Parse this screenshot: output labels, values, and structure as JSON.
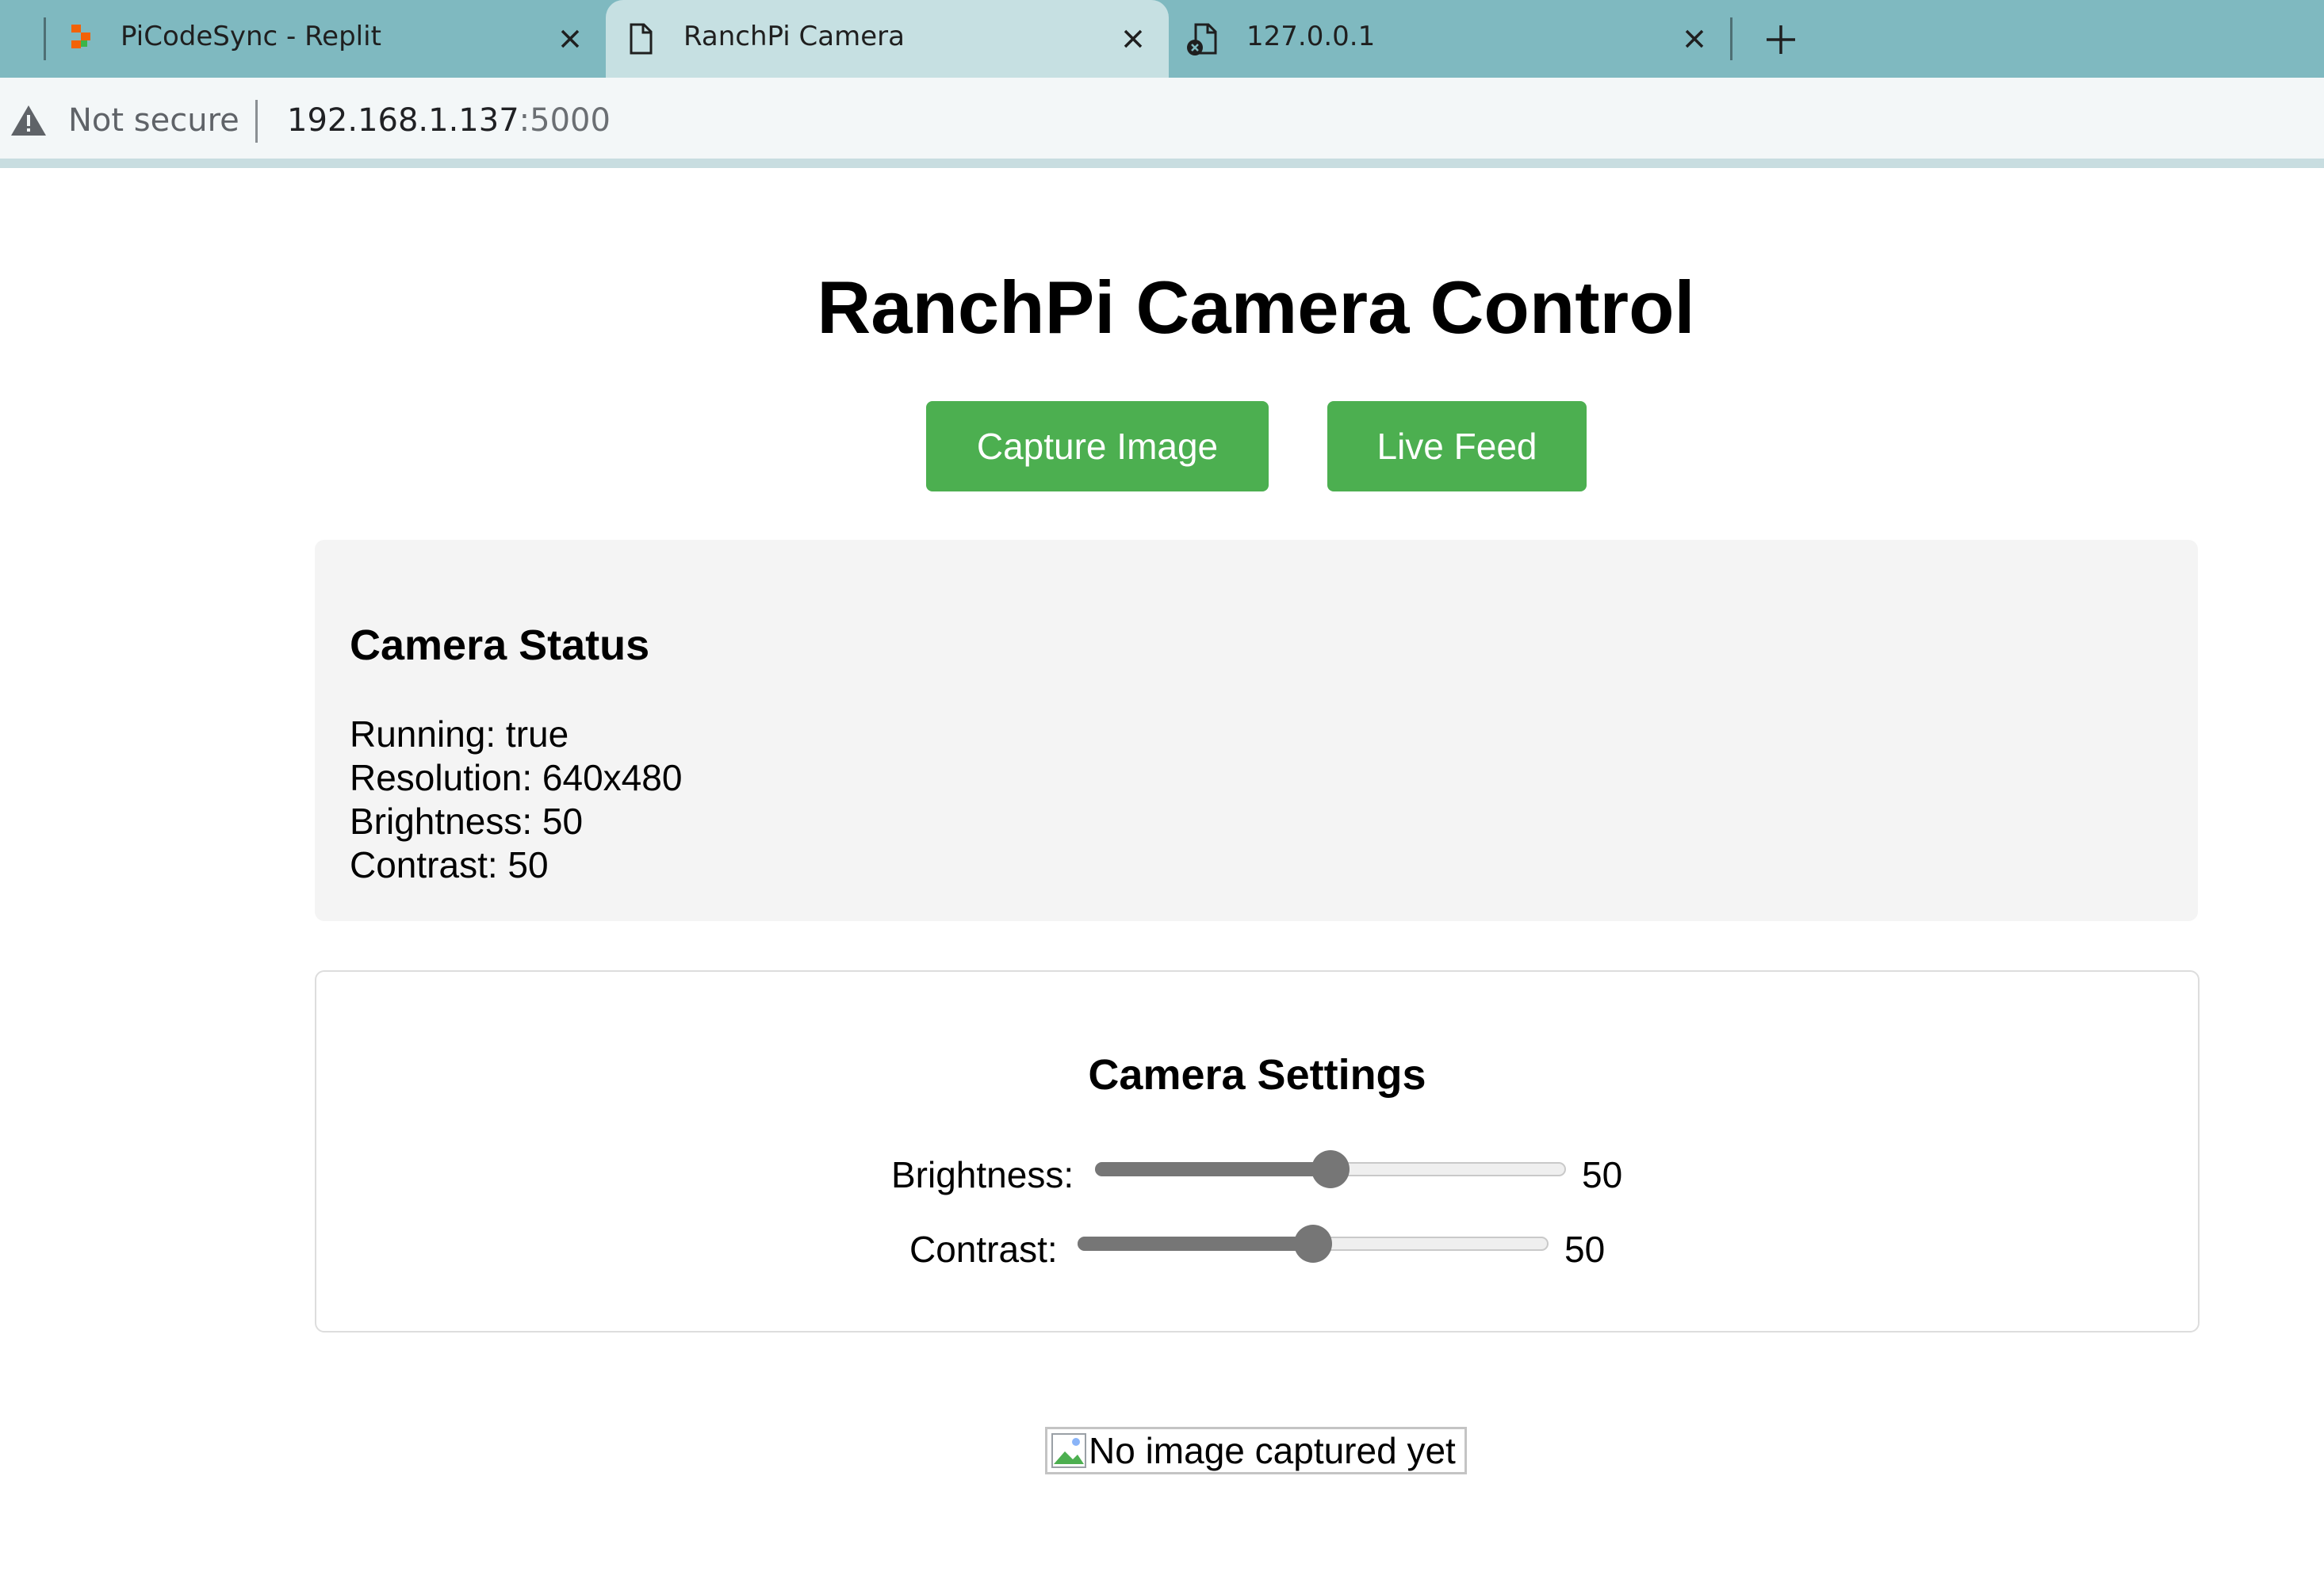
{
  "browser": {
    "tabs": [
      {
        "title": "PiCodeSync - Replit",
        "icon": "replit-icon",
        "active": false
      },
      {
        "title": "RanchPi Camera",
        "icon": "document-icon",
        "active": true
      },
      {
        "title": "127.0.0.1",
        "icon": "document-error-icon",
        "active": false
      }
    ],
    "new_tab_icon": "plus-icon",
    "address": {
      "security_label": "Not secure",
      "security_icon": "warning-icon",
      "host": "192.168.1.137",
      "port": ":5000"
    }
  },
  "page": {
    "title": "RanchPi Camera Control",
    "buttons": {
      "capture": "Capture Image",
      "live_feed": "Live Feed"
    },
    "status": {
      "heading": "Camera Status",
      "running": "Running: true",
      "resolution": "Resolution: 640x480",
      "brightness": "Brightness: 50",
      "contrast": "Contrast: 50"
    },
    "settings": {
      "heading": "Camera Settings",
      "brightness": {
        "label": "Brightness:",
        "value": "50",
        "level": 50,
        "min": 0,
        "max": 100
      },
      "contrast": {
        "label": "Contrast:",
        "value": "50",
        "level": 50,
        "min": 0,
        "max": 100
      }
    },
    "captured_image": {
      "alt": "No image captured yet",
      "icon": "broken-image-icon"
    }
  },
  "colors": {
    "tabstrip": "#7fb9c0",
    "active_tab": "#c6e0e2",
    "button_green": "#4caf50",
    "status_panel_bg": "#f4f4f4",
    "slider_fill": "#767676"
  }
}
